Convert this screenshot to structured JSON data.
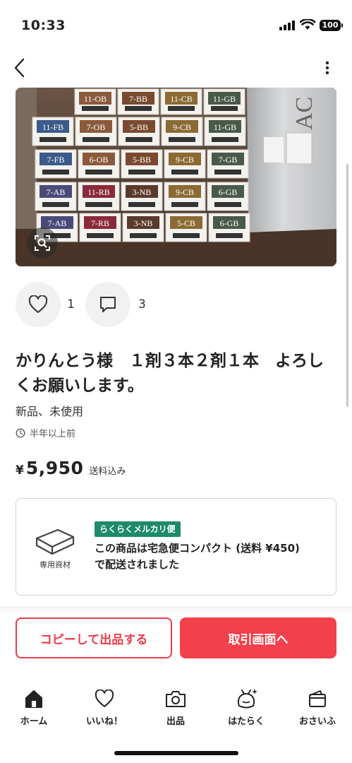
{
  "status": {
    "time": "10:33",
    "battery": "100"
  },
  "icons": {
    "back": "back-chevron-icon",
    "more": "more-vertical-icon",
    "zoom": "image-search-icon",
    "like": "heart-icon",
    "comment": "comment-icon",
    "clock": "clock-icon",
    "box": "box-icon"
  },
  "photo": {
    "labels": [
      "11-OB",
      "7-BB",
      "11-CB",
      "11-GB",
      "11-FB",
      "7-OB",
      "5-BB",
      "9-CB",
      "11-GB",
      "7-FB",
      "6-OB",
      "5-BB",
      "9-CB",
      "7-GB",
      "7-AB",
      "11-RB",
      "3-NB",
      "9-CB",
      "6-GB",
      "7-AB",
      "7-RB",
      "3-NB",
      "5-CB",
      "6-GB"
    ],
    "bag_text": "AC"
  },
  "actions": {
    "like_count": "1",
    "comment_count": "3"
  },
  "item": {
    "title": "かりんとう様　１剤３本２剤１本　よろしくお願いします。",
    "condition": "新品、未使用",
    "posted": "半年以上前",
    "price_symbol": "¥",
    "price": "5,950",
    "shipping_note": "送料込み"
  },
  "shipping": {
    "icon_label": "専用資材",
    "tag": "らくらくメルカリ便",
    "description": "この商品は宅急便コンパクト (送料 ¥450) で配送されました"
  },
  "buttons": {
    "copy": "コピーして出品する",
    "trade": "取引画面へ"
  },
  "tabs": [
    {
      "label": "ホーム",
      "icon": "home-icon"
    },
    {
      "label": "いいね！",
      "icon": "heart-icon"
    },
    {
      "label": "出品",
      "icon": "camera-icon"
    },
    {
      "label": "はたらく",
      "icon": "work-bag-icon"
    },
    {
      "label": "おさいふ",
      "icon": "wallet-icon"
    }
  ],
  "colors": {
    "accent": "#f2414b",
    "ship_tag": "#1d8a6a"
  }
}
